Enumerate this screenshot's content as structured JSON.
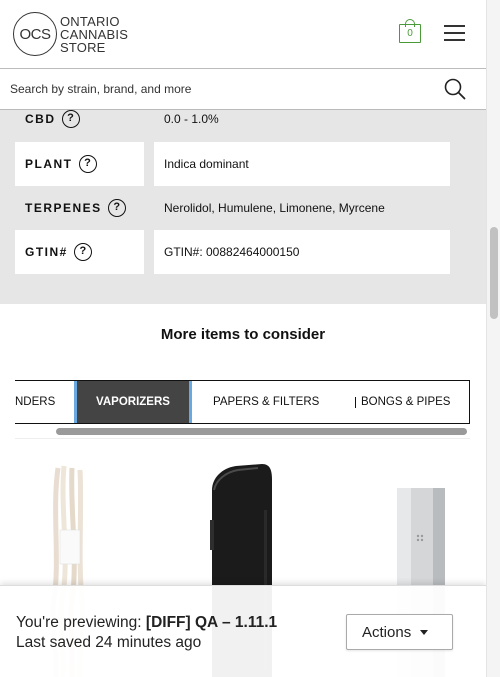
{
  "header": {
    "logo_short": "OCS",
    "logo_lines": [
      "ONTARIO",
      "CANNABIS",
      "STORE"
    ],
    "cart_count": "0",
    "cart_icon": "shopping-bag-icon",
    "menu_icon": "hamburger-menu-icon"
  },
  "search": {
    "placeholder": "Search by strain, brand, and more",
    "icon": "search-icon"
  },
  "specs": [
    {
      "label": "CBD",
      "value": "0.0 - 1.0%",
      "boxed": false
    },
    {
      "label": "PLANT",
      "value": "Indica dominant",
      "boxed": true
    },
    {
      "label": "TERPENES",
      "value": "Nerolidol, Humulene, Limonene, Myrcene",
      "boxed": false
    },
    {
      "label": "GTIN#",
      "value": "GTIN#: 00882464000150",
      "boxed": true
    }
  ],
  "help_glyph": "?",
  "more_items": {
    "title": "More items to consider",
    "tabs": [
      {
        "label": "NDERS",
        "active": false
      },
      {
        "label": "VAPORIZERS",
        "active": true
      },
      {
        "label": "PAPERS & FILTERS",
        "active": false
      },
      {
        "label": "BONGS & PIPES",
        "active": false
      }
    ],
    "products": [
      {
        "name": "pipe-cleaners-image"
      },
      {
        "name": "black-vaporizer-image"
      },
      {
        "name": "silver-vaporizer-image"
      }
    ]
  },
  "preview": {
    "prefix": "You're previewing: ",
    "build": "[DIFF] QA – 1.11.1",
    "saved": "Last saved 24 minutes ago",
    "actions_label": "Actions"
  },
  "colors": {
    "cart_green": "#4a9a3a",
    "spec_bg": "#e6e6e6",
    "active_tab_bg": "#444444",
    "active_tab_border": "#6aa8e0"
  }
}
